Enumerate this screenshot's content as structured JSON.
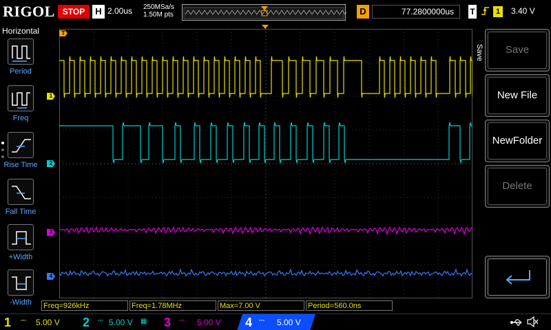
{
  "topbar": {
    "logo": "RIGOL",
    "run_state": "STOP",
    "hbase_key": "H",
    "hbase_value": "2.00us",
    "sample_rate": "250MSa/s",
    "mem_depth": "1.50M pts",
    "delay_key": "D",
    "delay_value": "77.2800000us",
    "trigger_key": "T",
    "trigger_edge_icon": "rising-edge-icon",
    "trigger_source": "1",
    "trigger_level": "3.40 V"
  },
  "left_panel": {
    "title": "Horizontal",
    "items": [
      {
        "label": "Period",
        "icon": "period-icon"
      },
      {
        "label": "Freq",
        "icon": "freq-icon"
      },
      {
        "label": "Rise Time",
        "icon": "rise-time-icon"
      },
      {
        "label": "Fall Time",
        "icon": "fall-time-icon"
      },
      {
        "label": "+Width",
        "icon": "pos-width-icon"
      },
      {
        "label": "-Width",
        "icon": "neg-width-icon"
      }
    ]
  },
  "right_menu": {
    "title": "Save",
    "buttons": [
      {
        "label": "Save",
        "enabled": false
      },
      {
        "label": "New File",
        "enabled": true
      },
      {
        "label": "NewFolder",
        "enabled": true
      },
      {
        "label": "Delete",
        "enabled": false
      },
      {
        "label": "",
        "icon": "enter-icon",
        "enabled": true
      }
    ]
  },
  "measurements": [
    {
      "text": "Freq=926kHz"
    },
    {
      "text": "Freq=1.78MHz"
    },
    {
      "text": "Max=7.00 V"
    },
    {
      "text": "Period=560.0ns"
    }
  ],
  "channels": [
    {
      "num": "1",
      "scale": "5.00 V",
      "color": "#e8e000"
    },
    {
      "num": "2",
      "scale": "5.00 V",
      "color": "#00d0d0"
    },
    {
      "num": "3",
      "scale": "5.00 V",
      "color": "#e000e0"
    },
    {
      "num": "4",
      "scale": "5.00 V",
      "color": "#2f7dff"
    }
  ],
  "colors": {
    "ch1": "#e8e000",
    "ch2": "#00d0d0",
    "ch3": "#e000e0",
    "ch4": "#2f7dff",
    "trigger": "#f5a000",
    "stop": "#e00000"
  }
}
